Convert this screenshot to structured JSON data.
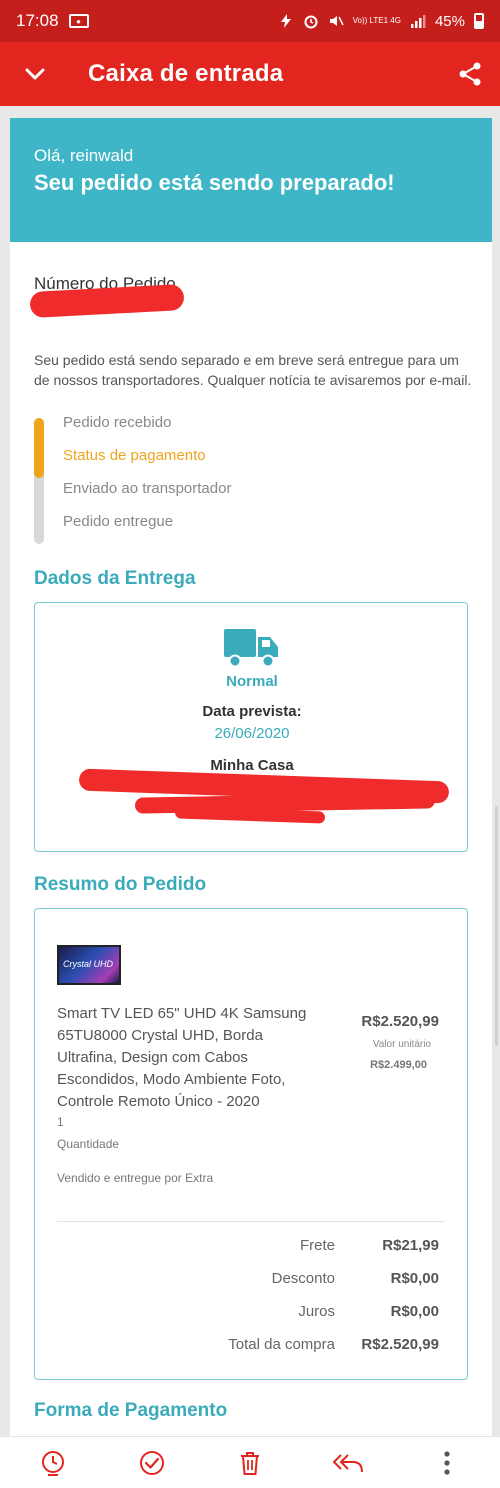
{
  "status_bar": {
    "time": "17:08",
    "network": "Vo)) LTE1 4G",
    "battery": "45%"
  },
  "app_bar": {
    "title": "Caixa de entrada"
  },
  "email": {
    "greeting": "Olá, reinwald",
    "headline": "Seu pedido está sendo preparado!",
    "order_number_label": "Número do Pedido",
    "description": "Seu pedido está sendo separado e em breve será entregue para um de nossos transportadores. Qualquer notícia te avisaremos por e-mail.",
    "progress": {
      "steps": [
        "Pedido recebido",
        "Status de pagamento",
        "Enviado ao transportador",
        "Pedido entregue"
      ],
      "active_step": "Status de pagamento",
      "completed_fraction": 0.5
    },
    "delivery": {
      "section_title": "Dados da Entrega",
      "method": "Normal",
      "expected_date_label": "Data prevista:",
      "expected_date": "26/06/2020",
      "address_name": "Minha Casa"
    },
    "summary": {
      "section_title": "Resumo do Pedido",
      "product": {
        "image_text": "Crystal UHD",
        "name": "Smart TV LED 65\" UHD 4K Samsung 65TU8000 Crystal UHD, Borda Ultrafina, Design com Cabos Escondidos, Modo Ambiente Foto, Controle Remoto Único - 2020",
        "price": "R$2.520,99",
        "unit_price_label": "Valor unitário",
        "unit_price": "R$2.499,00",
        "quantity": "1",
        "quantity_label": "Quantidade",
        "seller": "Vendido e entregue por Extra"
      },
      "totals": [
        {
          "label": "Frete",
          "value": "R$21,99"
        },
        {
          "label": "Desconto",
          "value": "R$0,00"
        },
        {
          "label": "Juros",
          "value": "R$0,00"
        },
        {
          "label": "Total da compra",
          "value": "R$2.520,99"
        }
      ]
    },
    "payment_section_title": "Forma de Pagamento"
  },
  "colors": {
    "status_bar": "#c51f1c",
    "app_bar": "#e2261f",
    "hero": "#3fb6c7",
    "accent_teal": "#3aabbb",
    "progress_active": "#f0a41b",
    "redaction": "#ef2b2b"
  },
  "bottom_actions": [
    "snooze-icon",
    "mark-done-icon",
    "delete-icon",
    "reply-all-icon",
    "more-icon"
  ]
}
